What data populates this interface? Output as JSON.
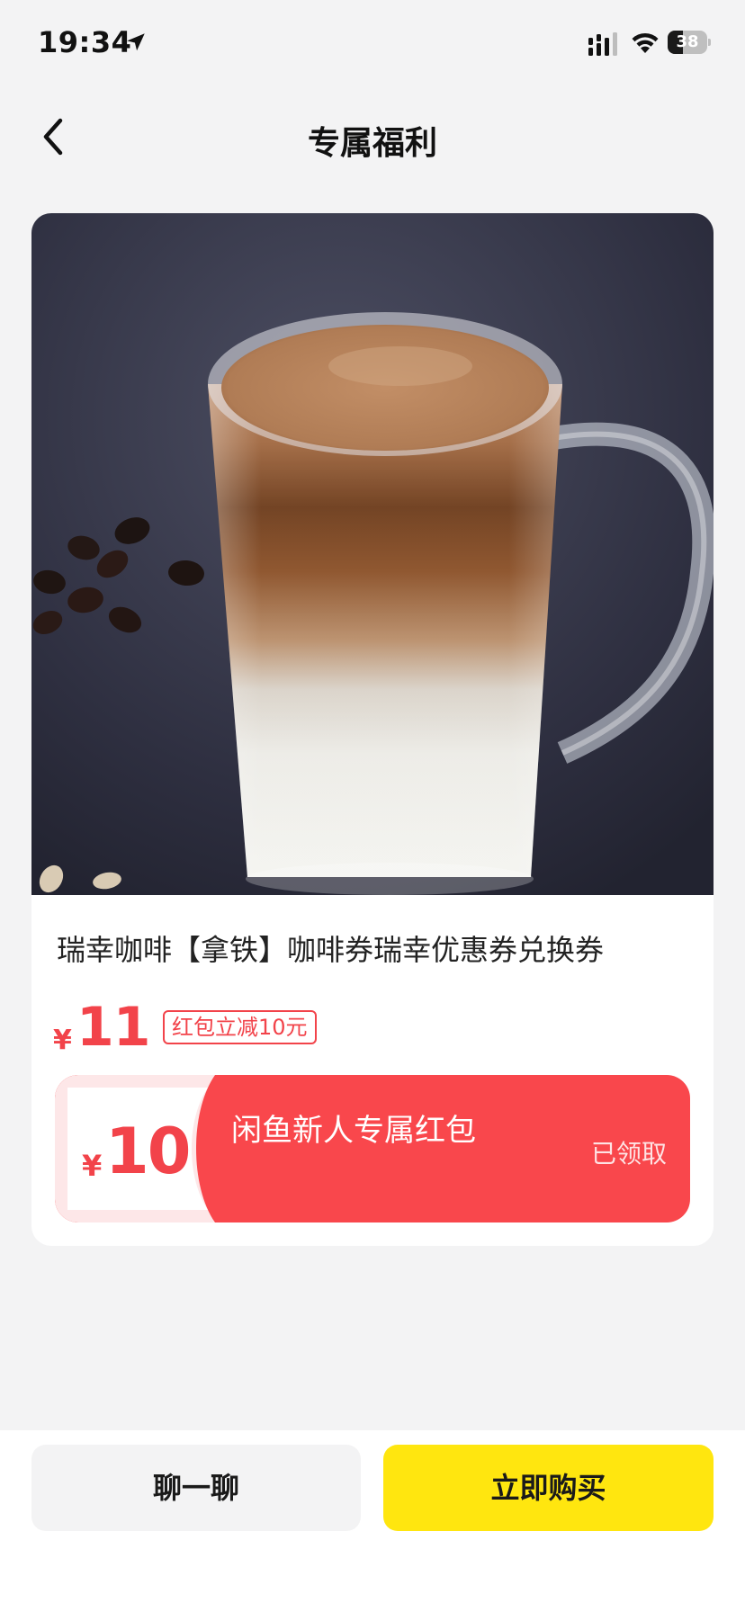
{
  "status_bar": {
    "time": "19:34",
    "battery_percent": 38,
    "battery_label": "38",
    "icons": [
      "location-arrow-icon",
      "signal-icon",
      "wifi-icon",
      "battery-icon"
    ]
  },
  "nav": {
    "title": "专属福利",
    "back_icon": "chevron-left-icon"
  },
  "product": {
    "title": "瑞幸咖啡【拿铁】咖啡券瑞幸优惠券兑换券",
    "currency_symbol": "¥",
    "price": "11",
    "discount_badge": "红包立减10元"
  },
  "coupon": {
    "currency_symbol": "¥",
    "amount": "10",
    "title": "闲鱼新人专属红包",
    "status": "已领取"
  },
  "actions": {
    "chat_label": "聊一聊",
    "buy_label": "立即购买"
  },
  "colors": {
    "accent_red": "#f2434a",
    "buy_yellow": "#ffe60f",
    "background": "#f3f3f4"
  }
}
